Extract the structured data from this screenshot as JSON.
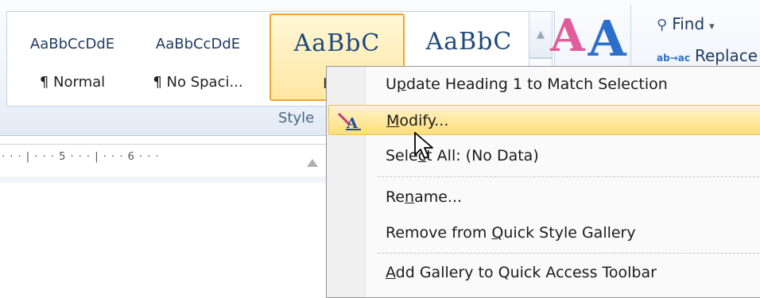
{
  "styles_gallery": {
    "tiles": [
      {
        "sample": "AaBbCcDdE",
        "name": "¶ Normal"
      },
      {
        "sample": "AaBbCcDdE",
        "name": "¶ No Spaci..."
      },
      {
        "sample": "AaBbC",
        "name": "Hea"
      },
      {
        "sample": "AaBbC",
        "name": ""
      }
    ],
    "group_label": "Style"
  },
  "editing": {
    "find_label": "Find",
    "replace_label": "Replace"
  },
  "ruler": {
    "marks": "· · · | · · · 5 · · · | · · · 6 · · ·"
  },
  "context_menu": {
    "items": [
      {
        "before": "U",
        "mnemonic": "p",
        "after": "date Heading 1 to Match Selection"
      },
      {
        "before": "",
        "mnemonic": "M",
        "after": "odify..."
      },
      {
        "before": "Sele",
        "mnemonic": "c",
        "after": "t All: (No Data)"
      },
      {
        "before": "Re",
        "mnemonic": "n",
        "after": "ame..."
      },
      {
        "before": "Remove from ",
        "mnemonic": "Q",
        "after": "uick Style Gallery"
      },
      {
        "before": "",
        "mnemonic": "A",
        "after": "dd Gallery to Quick Access Toolbar"
      }
    ],
    "highlighted_index": 1
  },
  "colors": {
    "highlight": "#ffde7a",
    "selected_border": "#f2a531",
    "accent_blue": "#2a6fc9"
  }
}
